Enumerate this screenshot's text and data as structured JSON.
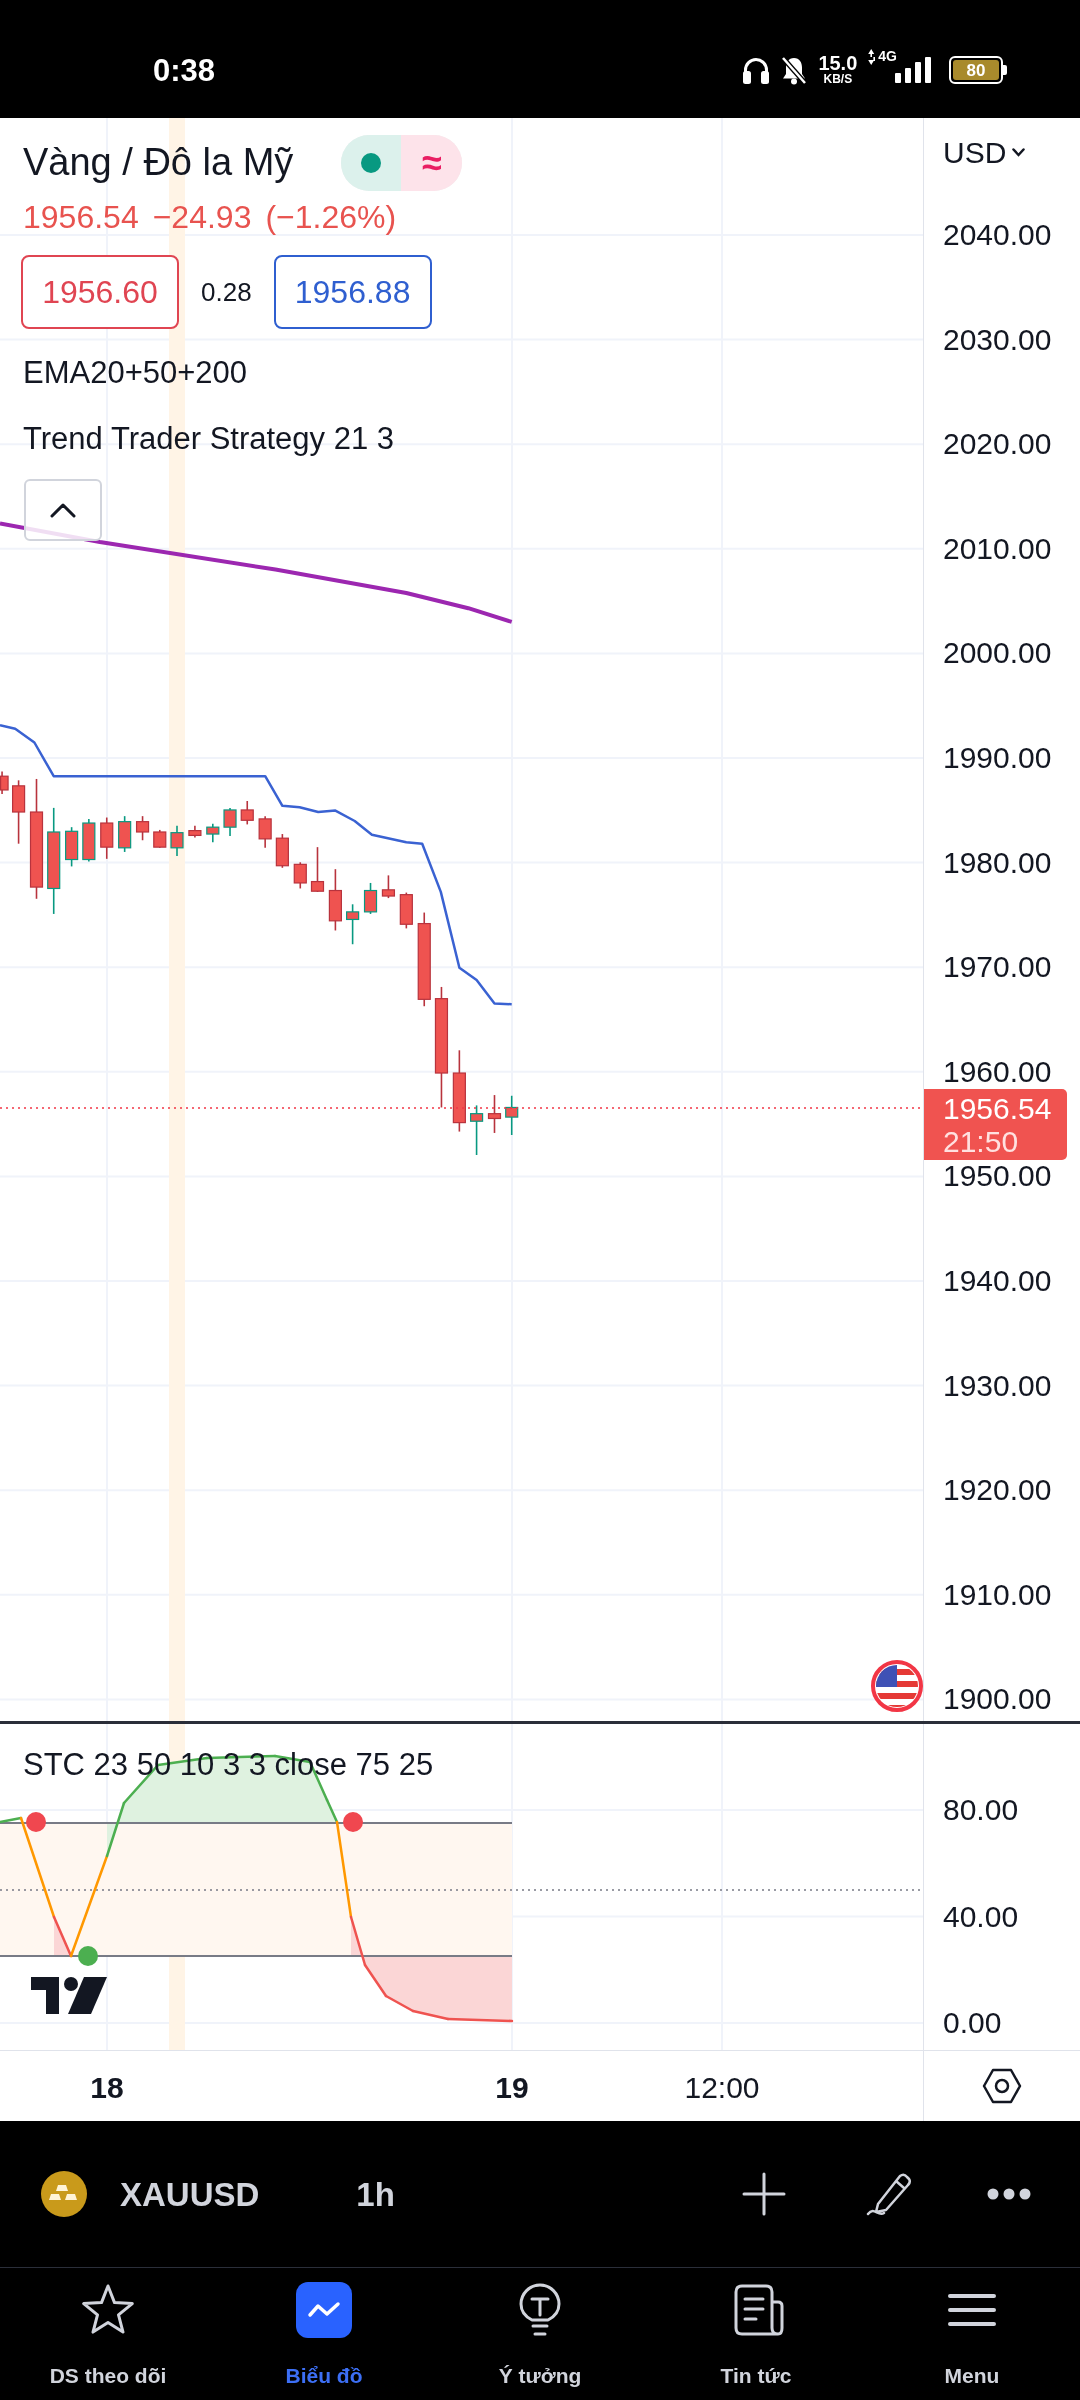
{
  "status_bar": {
    "time": "0:38",
    "speed": "15.0",
    "speed_unit": "KB/S",
    "network": "4G",
    "battery": "80"
  },
  "symbol_header": {
    "title": "Vàng / Đô la Mỹ",
    "market_open": true,
    "delay_symbol": "≈"
  },
  "quote": {
    "last": "1956.54",
    "change": "−24.93",
    "change_percent": "(−1.26%)",
    "negative": true
  },
  "bid_ask": {
    "sell": "1956.60",
    "spread": "0.28",
    "buy": "1956.88"
  },
  "indicators": [
    "EMA20+50+200",
    "Trend Trader Strategy 21 3"
  ],
  "legend": {
    "expanded": true
  },
  "price_axis": {
    "currency": "USD",
    "ticks": [
      "2040.00",
      "2030.00",
      "2020.00",
      "2010.00",
      "2000.00",
      "1990.00",
      "1980.00",
      "1970.00",
      "1960.00",
      "1950.00",
      "1940.00",
      "1930.00",
      "1920.00",
      "1910.00",
      "1900.00"
    ],
    "last_price": "1956.54",
    "countdown": "21:50"
  },
  "stc_pane": {
    "title": "STC 23 50 10 3 3 close 75 25",
    "ticks": [
      "80.00",
      "40.00",
      "0.00"
    ]
  },
  "time_axis": [
    {
      "label": "18",
      "kind": "day"
    },
    {
      "label": "19",
      "kind": "day"
    },
    {
      "label": "12:00",
      "kind": "time"
    }
  ],
  "toolbar": {
    "symbol": "XAUUSD",
    "interval": "1h"
  },
  "bottom_nav": [
    {
      "label": "DS theo dõi",
      "selected": false
    },
    {
      "label": "Biểu đồ",
      "selected": true
    },
    {
      "label": "Ý tưởng",
      "selected": false
    },
    {
      "label": "Tin tức",
      "selected": false
    },
    {
      "label": "Menu",
      "selected": false
    }
  ]
}
